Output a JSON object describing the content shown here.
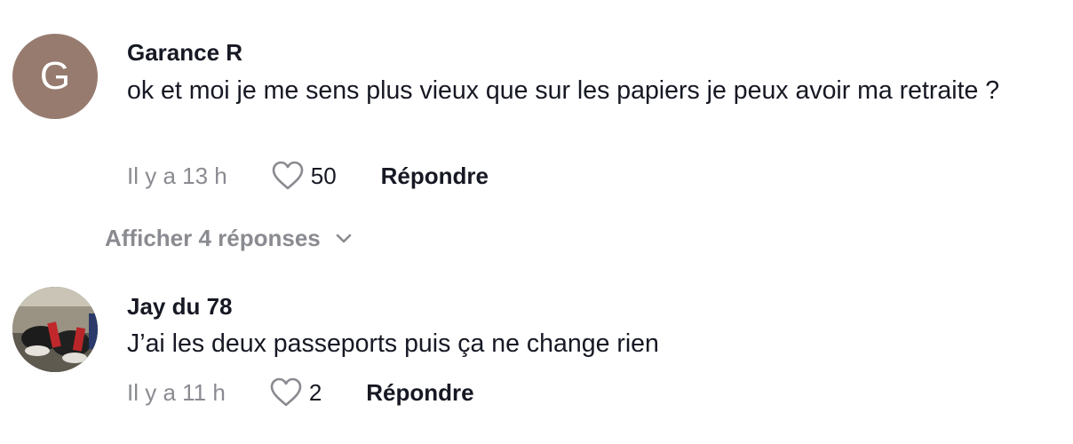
{
  "comments": [
    {
      "avatar_letter": "G",
      "username": "Garance R",
      "text": "ok et moi je me sens plus vieux que sur les papiers je peux avoir ma retraite ?",
      "time": "Il y a 13 h",
      "likes": "50",
      "reply_label": "Répondre"
    },
    {
      "username": "Jay du 78",
      "text": "J’ai les deux passeports puis ça ne change rien",
      "time": "Il y a 11 h",
      "likes": "2",
      "reply_label": "Répondre"
    }
  ],
  "view_replies_label": "Afficher 4 réponses",
  "colors": {
    "avatar_letter_bg": "#977b6f",
    "primary_text": "#161823",
    "secondary_text": "#8a8b91"
  },
  "icons": {
    "like": "heart-outline-icon",
    "expand": "chevron-down-icon"
  }
}
